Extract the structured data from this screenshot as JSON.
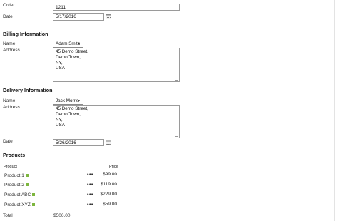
{
  "order": {
    "label": "Order",
    "value": "1211"
  },
  "order_date": {
    "label": "Date",
    "value": "5/17/2016"
  },
  "billing": {
    "heading": "Billing Information",
    "name_label": "Name",
    "name_value": "Adam Smith",
    "address_label": "Address",
    "address_lines": [
      "45 Demo Street,",
      "Demo Town,",
      "NY,",
      "USA"
    ]
  },
  "delivery": {
    "heading": "Delivery Information",
    "name_label": "Name",
    "name_value": "Jack Morris",
    "address_label": "Address",
    "address_lines": [
      "45 Demo Street,",
      "Demo Town,",
      "NY,",
      "USA"
    ],
    "date_label": "Date",
    "date_value": "5/26/2016"
  },
  "products": {
    "heading": "Products",
    "col_product": "Product",
    "col_price": "Price",
    "more_label": "•••",
    "items": [
      {
        "name": "Product 1",
        "price": "$99.00"
      },
      {
        "name": "Product 2",
        "price": "$119.00"
      },
      {
        "name": "Product ABC",
        "price": "$229.00"
      },
      {
        "name": "Product XYZ",
        "price": "$59.00"
      }
    ]
  },
  "total": {
    "label": "Total",
    "value": "$506.00"
  },
  "colors": {
    "indicator": "#7db63e",
    "border": "#9a9a9a"
  }
}
